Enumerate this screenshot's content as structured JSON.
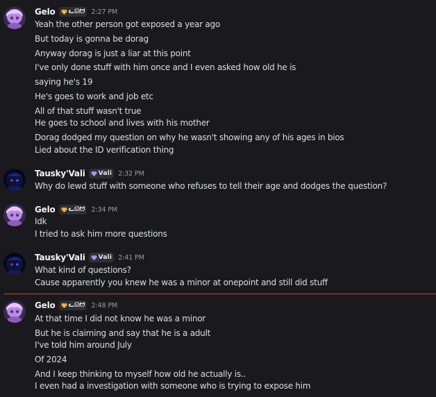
{
  "messages": [
    {
      "username": "Gelo",
      "tag": "ᓚᘏᗢ",
      "tag_icon": "heart-icon",
      "tag_color": "#f0b232",
      "time": "2:27 PM",
      "avatar": "purple-anime-avatar",
      "lines": [
        "Yeah the other person got exposed a year ago",
        "But today is gonna be dorag",
        "Anyway dorag is just a liar at this point",
        "I've only done stuff with him once and I even asked how old he is",
        "saying he's 19",
        "He's goes to work and job etc",
        "All of that stuff wasn't true",
        "He goes to school and lives with his mother",
        "Dorag dodged my question on why he wasn't showing any of his ages in bios",
        "Lied about the ID verification thing"
      ]
    },
    {
      "username": "Tausky'Vali",
      "tag": "Vali",
      "tag_icon": "heart-icon",
      "tag_color": "#b38cf5",
      "time": "2:32 PM",
      "avatar": "dark-blue-avatar",
      "lines": [
        "Why do lewd stuff with someone who refuses to tell their age and dodges the question?"
      ]
    },
    {
      "username": "Gelo",
      "tag": "ᓚᘏᗢ",
      "tag_icon": "heart-icon",
      "tag_color": "#f0b232",
      "time": "2:34 PM",
      "avatar": "purple-anime-avatar",
      "lines": [
        "Idk",
        "I tried to ask him more questions"
      ]
    },
    {
      "username": "Tausky'Vali",
      "tag": "Vali",
      "tag_icon": "heart-icon",
      "tag_color": "#b38cf5",
      "time": "2:41 PM",
      "avatar": "dark-blue-avatar",
      "lines": [
        "What kind of questions?",
        "Cause apparently you knew he was a minor at onepoint and still did stuff"
      ]
    },
    {
      "username": "Gelo",
      "tag": "ᓚᘏᗢ",
      "tag_icon": "heart-icon",
      "tag_color": "#f0b232",
      "time": "2:48 PM",
      "avatar": "purple-anime-avatar",
      "lines": [
        "At that time I did not know he was a minor",
        "But he is claiming and say that he is a adult",
        "I've told him around July",
        "Of 2024",
        "And I keep thinking to myself how old he actually is..",
        "I even had a investigation with someone who is trying to expose him"
      ]
    }
  ],
  "colors": {
    "background": "#1a1a1e",
    "text": "#dbdee1",
    "username": "#f2f3f5",
    "timestamp": "#9a9ca3",
    "new_messages_divider": "#d83c3e"
  }
}
